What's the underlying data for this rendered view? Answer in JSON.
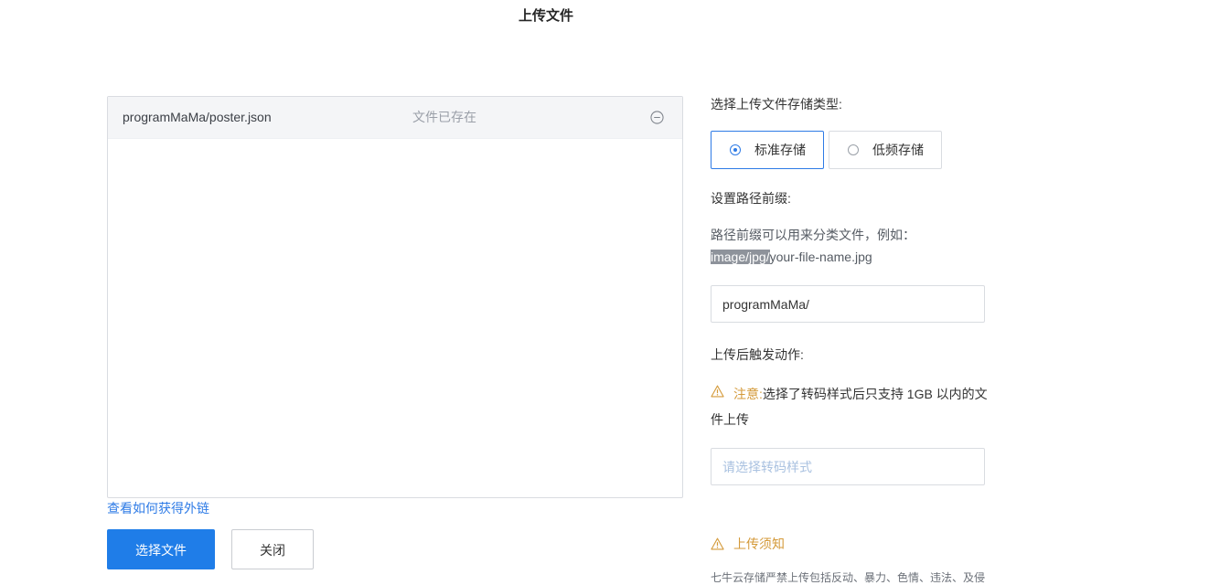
{
  "dialog": {
    "title": "上传文件"
  },
  "files": [
    {
      "name": "programMaMa/poster.json",
      "status": "文件已存在"
    }
  ],
  "left_actions": {
    "ext_link": "查看如何获得外链",
    "select_button": "选择文件",
    "close_button": "关闭"
  },
  "storage": {
    "label": "选择上传文件存储类型:",
    "options": [
      {
        "label": "标准存储",
        "selected": true
      },
      {
        "label": "低频存储",
        "selected": false
      }
    ]
  },
  "prefix": {
    "label": "设置路径前缀:",
    "help_line1": "路径前缀可以用来分类文件，例如：",
    "example_prefix": "image/jpg/",
    "example_file": "your-file-name.jpg",
    "value": "programMaMa/"
  },
  "trigger": {
    "label": "上传后触发动作:",
    "notice_label": "注意:",
    "notice_text": "选择了转码样式后只支持 1GB 以内的文件上传",
    "select_placeholder": "请选择转码样式"
  },
  "upload_notice": {
    "title": "上传须知",
    "text": "七牛云存储严禁上传包括反动、暴力、色情、违法、及侵"
  },
  "colors": {
    "primary": "#1f7de8",
    "link": "#2e7be6",
    "warning": "#d49a3a"
  }
}
